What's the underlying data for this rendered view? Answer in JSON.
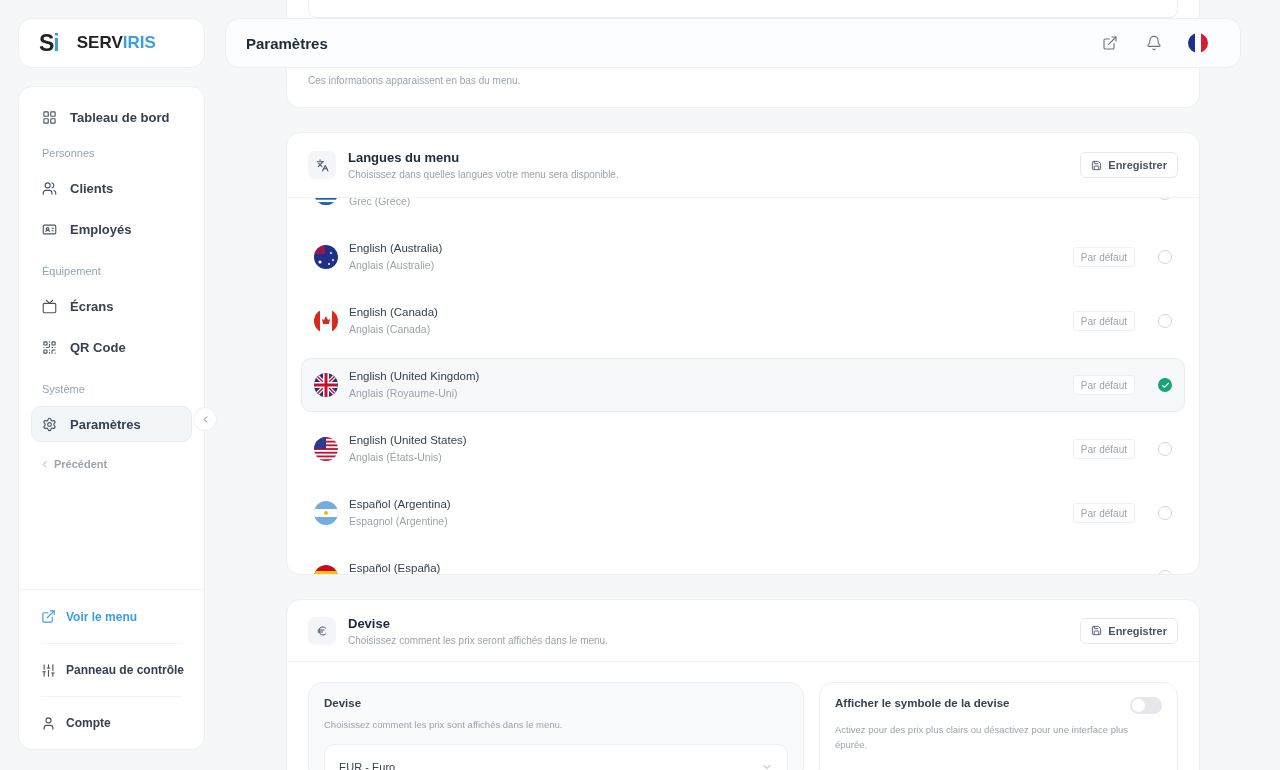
{
  "logo": {
    "mark": [
      "S",
      "i"
    ],
    "name": [
      "SERV",
      "IRIS"
    ]
  },
  "header": {
    "title": "Paramètres"
  },
  "sidebar": {
    "items": [
      {
        "kind": "link",
        "label": "Tableau de bord",
        "selected": false
      },
      {
        "kind": "section",
        "label": "Personnes"
      },
      {
        "kind": "link",
        "label": "Clients",
        "selected": false
      },
      {
        "kind": "link",
        "label": "Employés",
        "selected": false
      },
      {
        "kind": "section",
        "label": "Équipement"
      },
      {
        "kind": "link",
        "label": "Écrans",
        "selected": false
      },
      {
        "kind": "link",
        "label": "QR Code",
        "selected": false
      },
      {
        "kind": "section",
        "label": "Système"
      },
      {
        "kind": "link",
        "label": "Paramètres",
        "selected": true
      },
      {
        "kind": "back",
        "label": "Précédent"
      }
    ],
    "footer": [
      {
        "kind": "accent",
        "label": "Voir le menu"
      },
      {
        "kind": "plain",
        "label": "Panneau de contrôle"
      },
      {
        "kind": "plain",
        "label": "Compte"
      }
    ]
  },
  "info_card": {
    "note": "Ces informations apparaissent en bas du menu."
  },
  "languages": {
    "title": "Langues du menu",
    "subtitle": "Choisissez dans quelles langues votre menu sera disponible.",
    "save": "Enregistrer",
    "rows": [
      {
        "subtitle": "Grec (Grèce)",
        "selected": false
      },
      {
        "name": "English (Australia)",
        "subtitle": "Anglais (Australie)",
        "default_label": "Par défaut",
        "selected": false
      },
      {
        "name": "English (Canada)",
        "subtitle": "Anglais (Canada)",
        "default_label": "Par défaut",
        "selected": false
      },
      {
        "name": "English (United Kingdom)",
        "subtitle": "Anglais (Royaume-Uni)",
        "default_label": "Par défaut",
        "selected": true
      },
      {
        "name": "English (United States)",
        "subtitle": "Anglais (États-Unis)",
        "default_label": "Par défaut",
        "selected": false
      },
      {
        "name": "Español (Argentina)",
        "subtitle": "Espagnol (Argentine)",
        "default_label": "Par défaut",
        "selected": false
      },
      {
        "name": "Español (España)",
        "selected": false
      }
    ]
  },
  "currency": {
    "title": "Devise",
    "subtitle": "Choisissez comment les prix seront affichés dans le menu.",
    "save": "Enregistrer",
    "select_panel": {
      "label": "Devise",
      "help": "Choisissez comment les prix sont affichés dans le menu.",
      "value": "EUR - Euro"
    },
    "symbol_panel": {
      "label": "Afficher le symbole de la devise",
      "help": "Activez pour des prix plus clairs ou désactivez pour une interface plus épurée.",
      "on": false
    }
  }
}
